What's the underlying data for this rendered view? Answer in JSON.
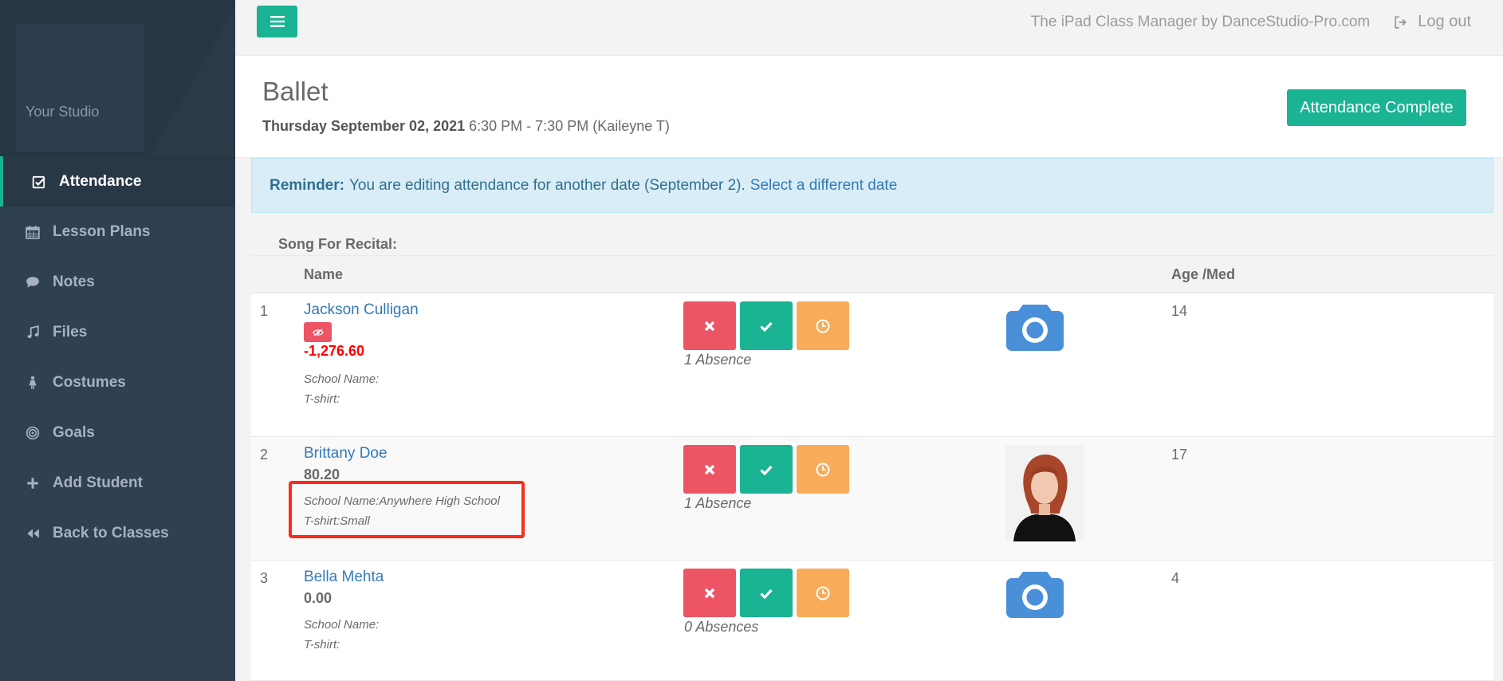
{
  "sidebar": {
    "studio_name": "Your Studio",
    "items": [
      {
        "label": "Attendance",
        "icon": "check-square-icon",
        "active": true
      },
      {
        "label": "Lesson Plans",
        "icon": "calendar-icon"
      },
      {
        "label": "Notes",
        "icon": "comment-icon"
      },
      {
        "label": "Files",
        "icon": "music-icon"
      },
      {
        "label": "Costumes",
        "icon": "female-icon"
      },
      {
        "label": "Goals",
        "icon": "target-icon"
      },
      {
        "label": "Add Student",
        "icon": "plus-icon"
      },
      {
        "label": "Back to Classes",
        "icon": "backward-icon"
      }
    ]
  },
  "topbar": {
    "brand_text": "The iPad Class Manager by DanceStudio-Pro.com",
    "logout_label": "Log out"
  },
  "header": {
    "title": "Ballet",
    "date": "Thursday September 02, 2021",
    "time_info": "6:30 PM - 7:30 PM (Kaileyne T)",
    "complete_button": "Attendance Complete"
  },
  "reminder": {
    "label": "Reminder:",
    "text": "You are editing attendance for another date (September 2).",
    "link": "Select a different date"
  },
  "table": {
    "song_label": "Song For Recital:",
    "columns": {
      "name": "Name",
      "age": "Age /Med"
    },
    "rows": [
      {
        "num": "1",
        "name": "Jackson Culligan",
        "balance": "-1,276.60",
        "balance_negative": true,
        "school": "School Name:",
        "tshirt": "T-shirt:",
        "absences": "1 Absence",
        "age": "14",
        "photo": "camera-icon"
      },
      {
        "num": "2",
        "name": "Brittany Doe",
        "balance": "80.20",
        "school": "School Name:Anywhere High School",
        "tshirt": "T-shirt:Small",
        "absences": "1 Absence",
        "age": "17",
        "photo": "student-photo"
      },
      {
        "num": "3",
        "name": "Bella Mehta",
        "balance": "0.00",
        "school": "School Name:",
        "tshirt": "T-shirt:",
        "absences": "0 Absences",
        "age": "4",
        "photo": "camera-icon"
      }
    ]
  },
  "colors": {
    "primary": "#1ab394",
    "danger": "#ed5565",
    "warning": "#f8ac59",
    "link": "#337ab7",
    "sidebar": "#2f4050",
    "highlight": "#ff2a1a"
  }
}
